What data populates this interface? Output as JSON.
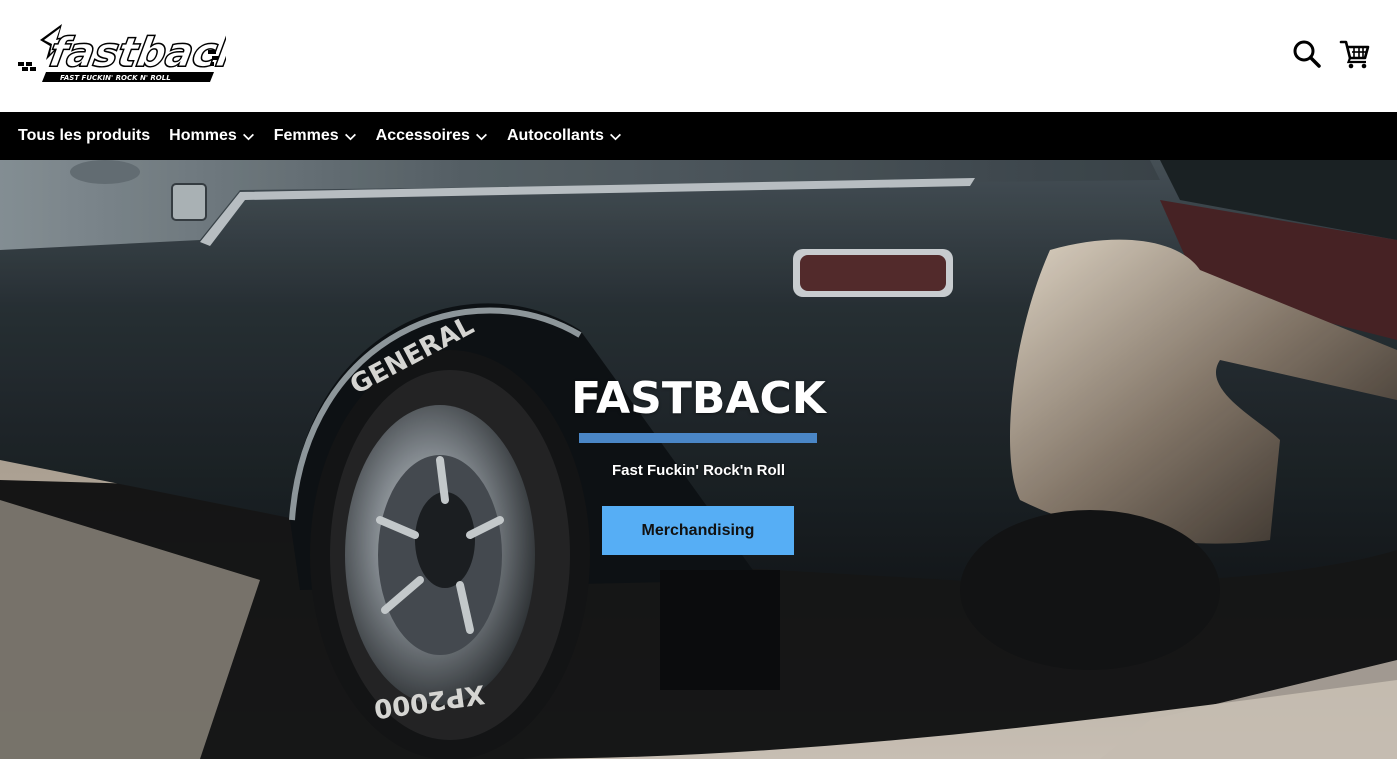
{
  "brand": {
    "logo_text": "fastback",
    "logo_tagline": "FAST FUCKIN' ROCK N' ROLL"
  },
  "header": {
    "search_icon": "search-icon",
    "cart_icon": "cart-icon"
  },
  "nav": {
    "items": [
      {
        "label": "Tous les produits",
        "has_dropdown": false
      },
      {
        "label": "Hommes",
        "has_dropdown": true
      },
      {
        "label": "Femmes",
        "has_dropdown": true
      },
      {
        "label": "Accessoires",
        "has_dropdown": true
      },
      {
        "label": "Autocollants",
        "has_dropdown": true
      }
    ]
  },
  "hero": {
    "title": "FASTBACK",
    "subtitle": "Fast Fuckin' Rock'n Roll",
    "cta_label": "Merchandising",
    "tire_text_top": "GENERAL",
    "tire_text_bottom": "XP2000"
  },
  "colors": {
    "nav_bg": "#000000",
    "accent_underline": "#4a86c6",
    "cta_bg": "#56aef5"
  }
}
